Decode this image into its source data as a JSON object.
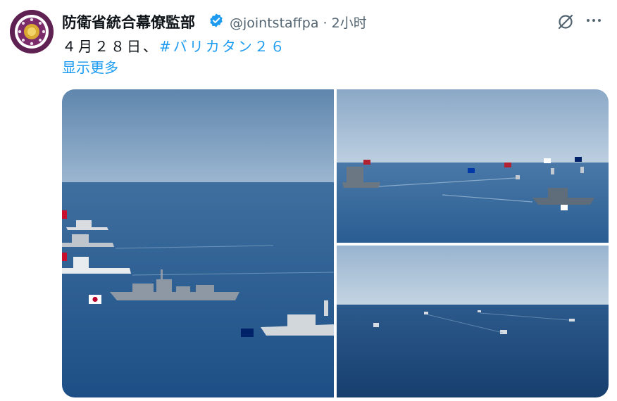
{
  "tweet": {
    "author_name": "防衛省統合幕僚監部",
    "handle": "@jointstaffpa",
    "separator": "·",
    "time": "2小时",
    "text_prefix": "４月２８日、",
    "hashtag": "#バリカタン２６",
    "show_more": "显示更多"
  },
  "icons": {
    "avatar": "jsdf-emblem-avatar",
    "verified": "verified-badge-icon",
    "grok": "grok-icon",
    "more": "more-icon"
  },
  "colors": {
    "link": "#1d9bf0",
    "text": "#0f1419",
    "secondary": "#536471",
    "sea": "#2d5f96",
    "sky": "#a6c1da"
  },
  "media": {
    "photos": [
      {
        "alt": "ship formation photo 1"
      },
      {
        "alt": "ship formation photo 2"
      },
      {
        "alt": "ship formation photo 3"
      }
    ]
  }
}
